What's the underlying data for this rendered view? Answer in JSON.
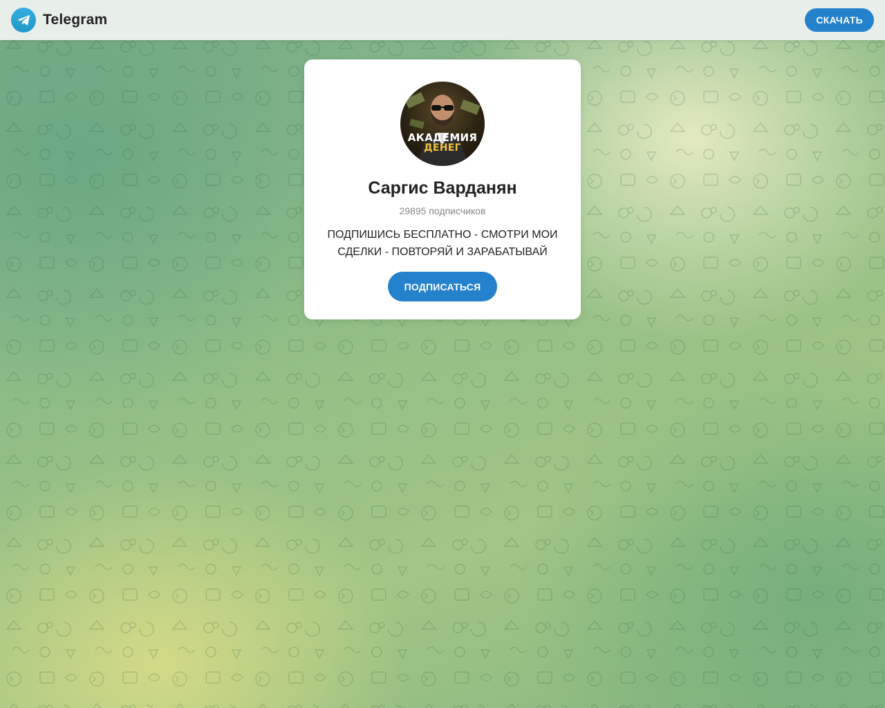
{
  "header": {
    "brand_name": "Telegram",
    "download_label": "СКАЧАТЬ"
  },
  "channel": {
    "avatar_line1": "АКАДЕМИЯ",
    "avatar_line2": "ДЕНЕГ",
    "title": "Саргис Варданян",
    "subscribers": "29895 подписчиков",
    "description": "ПОДПИШИСЬ БЕСПЛАТНО - СМОТРИ МОИ СДЕЛКИ - ПОВТОРЯЙ И ЗАРАБАТЫВАЙ",
    "subscribe_label": "ПОДПИСАТЬСЯ"
  },
  "icons": {
    "brand": "telegram-logo-icon"
  },
  "colors": {
    "accent": "#2481cc",
    "telegram_blue": "#37aee2",
    "header_bg": "#e8eeea",
    "avatar_accent": "#f2c13a"
  }
}
